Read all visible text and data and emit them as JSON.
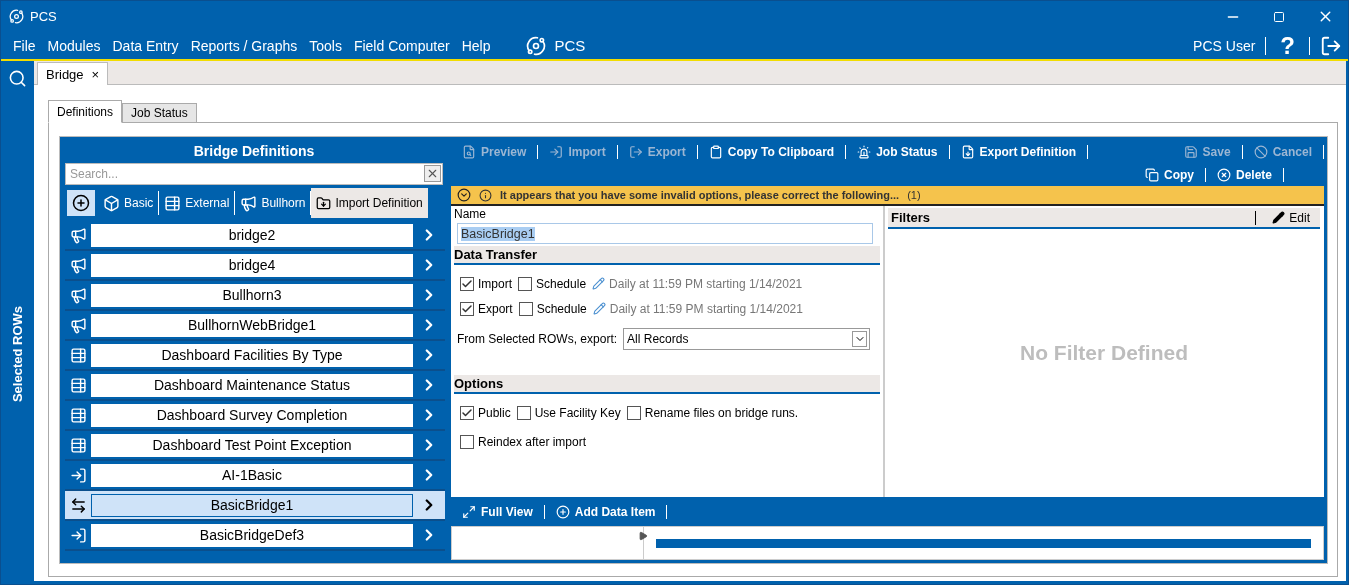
{
  "window": {
    "title": "PCS"
  },
  "menu": [
    "File",
    "Modules",
    "Data Entry",
    "Reports / Graphs",
    "Tools",
    "Field Computer",
    "Help"
  ],
  "brand": "PCS",
  "user": "PCS User",
  "help": "?",
  "rail": {
    "label": "Selected ROWs"
  },
  "doc_tabs": [
    {
      "label": "Bridge",
      "close": "×",
      "selected": true
    }
  ],
  "tabs": [
    {
      "label": "Definitions",
      "selected": true
    },
    {
      "label": "Job Status",
      "selected": false
    }
  ],
  "definitions": {
    "title": "Bridge Definitions",
    "search": {
      "placeholder": "Search..."
    },
    "type_buttons": [
      {
        "kind": "add",
        "selected": true
      },
      {
        "kind": "basic",
        "label": "Basic",
        "selected": false
      },
      {
        "kind": "external",
        "label": "External",
        "selected": false
      },
      {
        "kind": "bullhorn",
        "label": "Bullhorn",
        "selected": false
      },
      {
        "kind": "import",
        "label": "Import Definition",
        "selected": false
      }
    ],
    "items": [
      {
        "name": "bridge2",
        "kind": "bullhorn",
        "selected": false
      },
      {
        "name": "bridge4",
        "kind": "bullhorn",
        "selected": false
      },
      {
        "name": "Bullhorn3",
        "kind": "bullhorn",
        "selected": false
      },
      {
        "name": "BullhornWebBridge1",
        "kind": "bullhorn",
        "selected": false
      },
      {
        "name": "Dashboard Facilities By Type",
        "kind": "external",
        "selected": false
      },
      {
        "name": "Dashboard Maintenance Status",
        "kind": "external",
        "selected": false
      },
      {
        "name": "Dashboard Survey Completion",
        "kind": "external",
        "selected": false
      },
      {
        "name": "Dashboard Test Point Exception",
        "kind": "external",
        "selected": false
      },
      {
        "name": "AI-1Basic",
        "kind": "import",
        "selected": false
      },
      {
        "name": "BasicBridge1",
        "kind": "basic",
        "selected": true
      },
      {
        "name": "BasicBridgeDef3",
        "kind": "import",
        "selected": false
      }
    ]
  },
  "toolbar": {
    "left": [
      {
        "kind": "preview",
        "label": "Preview",
        "disabled": true
      },
      {
        "kind": "import",
        "label": "Import",
        "disabled": true
      },
      {
        "kind": "export",
        "label": "Export",
        "disabled": true
      },
      {
        "kind": "clipboard",
        "label": "Copy To Clipboard",
        "disabled": false
      },
      {
        "kind": "job",
        "label": "Job Status",
        "disabled": false
      },
      {
        "kind": "export-def",
        "label": "Export Definition",
        "disabled": false
      }
    ],
    "right": [
      {
        "kind": "save",
        "label": "Save",
        "disabled": true
      },
      {
        "kind": "cancel",
        "label": "Cancel",
        "disabled": true
      }
    ],
    "second_row": [
      {
        "kind": "copy",
        "label": "Copy",
        "disabled": false
      },
      {
        "kind": "delete",
        "label": "Delete",
        "disabled": false
      }
    ]
  },
  "warning": {
    "message": "It appears that you have some invalid options, please correct the following...",
    "count": "(1)"
  },
  "form": {
    "name_label": "Name",
    "name_value": "BasicBridge1",
    "data_transfer": {
      "title": "Data Transfer",
      "rows": [
        {
          "label": "Import",
          "checked": true,
          "schedule_label": "Schedule",
          "schedule_checked": false,
          "summary": "Daily at 11:59 PM starting 1/14/2021"
        },
        {
          "label": "Export",
          "checked": true,
          "schedule_label": "Schedule",
          "schedule_checked": false,
          "summary": "Daily at 11:59 PM starting 1/14/2021"
        }
      ],
      "export_from": {
        "label": "From Selected ROWs, export:",
        "value": "All Records"
      }
    },
    "options": {
      "title": "Options",
      "rows": [
        [
          {
            "label": "Public",
            "checked": true
          },
          {
            "label": "Use Facility Key",
            "checked": false
          },
          {
            "label": "Rename files on bridge runs.",
            "checked": false
          }
        ],
        [
          {
            "label": "Reindex after import",
            "checked": false
          }
        ]
      ]
    }
  },
  "filters": {
    "title": "Filters",
    "edit": "Edit",
    "empty": "No Filter Defined"
  },
  "bottom_toolbar": [
    {
      "kind": "full-view",
      "label": "Full View"
    },
    {
      "kind": "add",
      "label": "Add Data Item"
    }
  ]
}
